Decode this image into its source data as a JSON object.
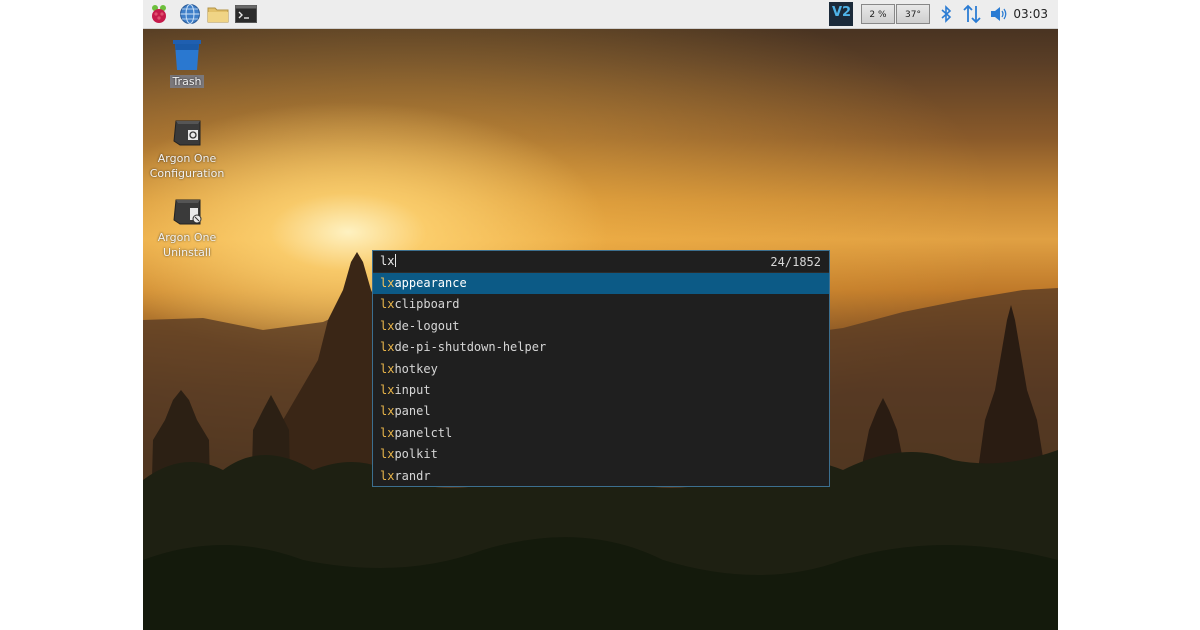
{
  "taskbar": {
    "launchers": [
      {
        "icon": "raspberry-icon"
      },
      {
        "icon": "web-browser-icon"
      },
      {
        "icon": "file-manager-icon"
      },
      {
        "icon": "terminal-icon"
      }
    ],
    "vnc_label": "V2",
    "cpu_usage": "2 %",
    "cpu_temp": "37°",
    "clock": "03:03",
    "tray_icons": [
      "bluetooth-icon",
      "network-icon",
      "volume-icon"
    ]
  },
  "desktop": {
    "icons": [
      {
        "label": "Trash",
        "icon": "trash-icon",
        "selected": true
      },
      {
        "label": "Argon One Configuration",
        "icon": "argon-config-icon",
        "selected": false
      },
      {
        "label": "Argon One Uninstall",
        "icon": "argon-uninstall-icon",
        "selected": false
      }
    ]
  },
  "launcher": {
    "query": "lx",
    "count": "24/1852",
    "results": [
      {
        "match": "lx",
        "rest": "appearance",
        "active": true
      },
      {
        "match": "lx",
        "rest": "clipboard",
        "active": false
      },
      {
        "match": "lx",
        "rest": "de-logout",
        "active": false
      },
      {
        "match": "lx",
        "rest": "de-pi-shutdown-helper",
        "active": false
      },
      {
        "match": "lx",
        "rest": "hotkey",
        "active": false
      },
      {
        "match": "lx",
        "rest": "input",
        "active": false
      },
      {
        "match": "lx",
        "rest": "panel",
        "active": false
      },
      {
        "match": "lx",
        "rest": "panelctl",
        "active": false
      },
      {
        "match": "lx",
        "rest": "polkit",
        "active": false
      },
      {
        "match": "lx",
        "rest": "randr",
        "active": false
      }
    ]
  },
  "colors": {
    "accent": "#0c5a86",
    "match_highlight": "#e8b54a",
    "launcher_bg": "#1f1f1f"
  }
}
